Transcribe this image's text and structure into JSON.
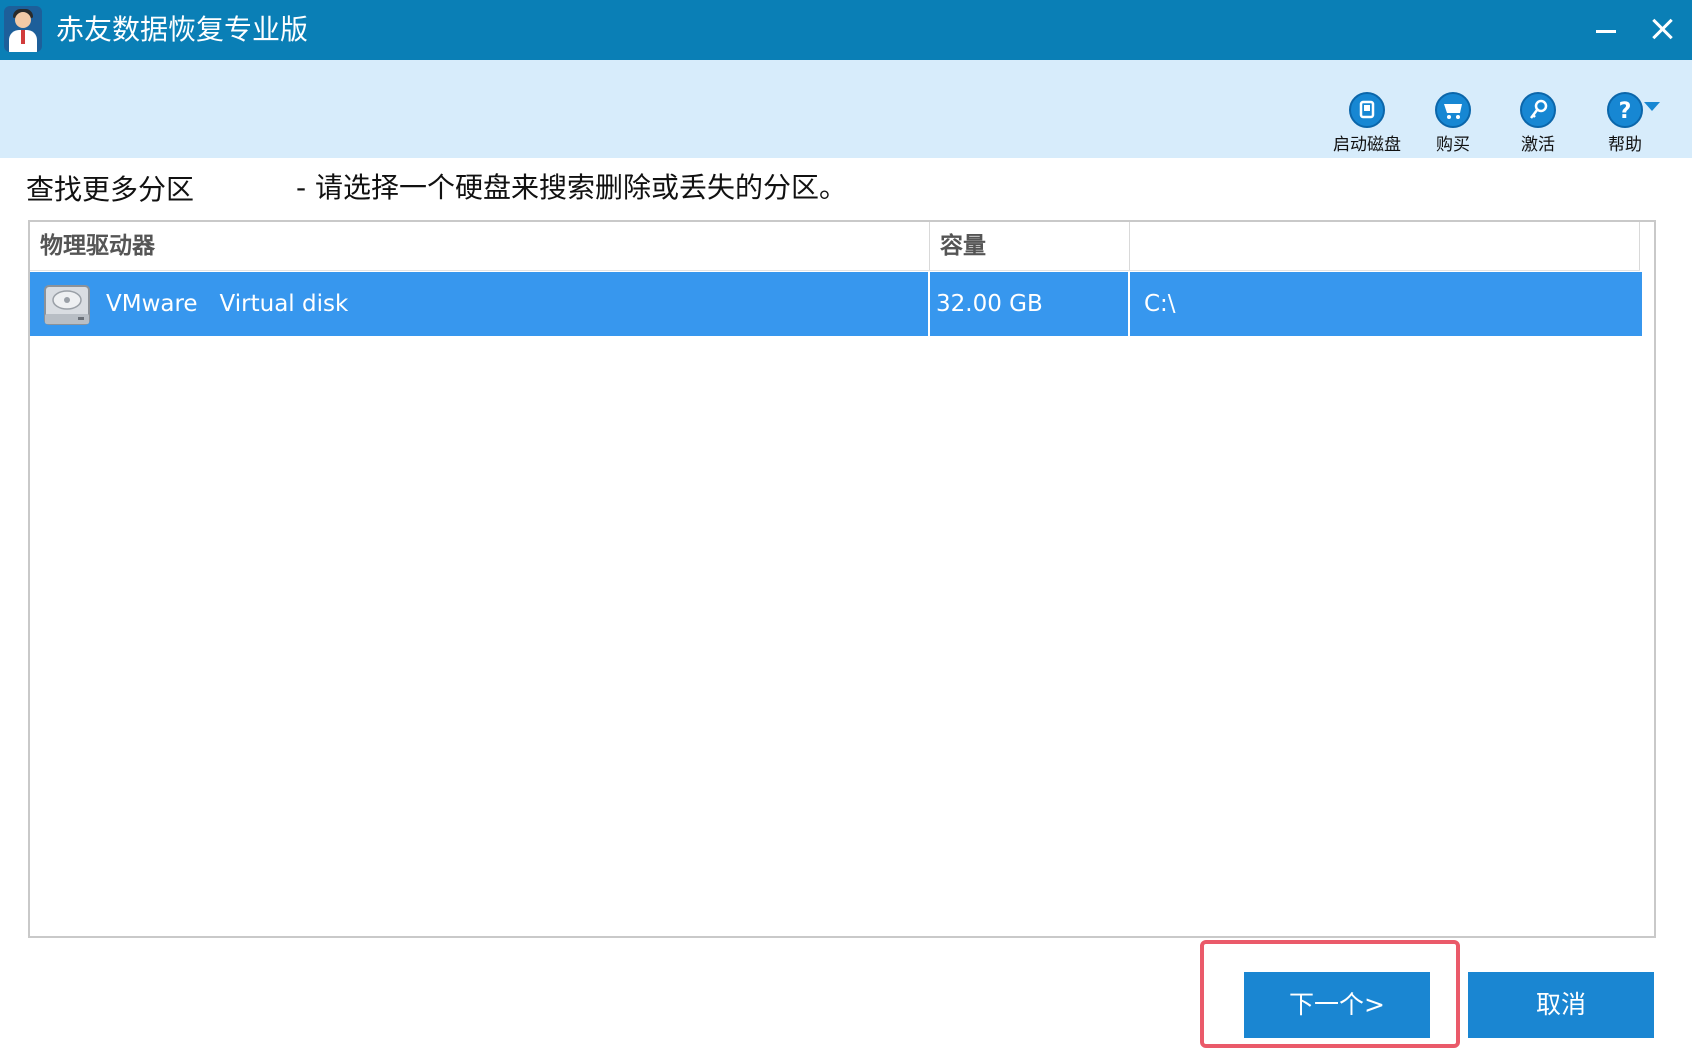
{
  "window": {
    "title": "赤友数据恢复专业版"
  },
  "toolbar": {
    "items": [
      {
        "label": "启动磁盘",
        "icon": "boot-disk-icon"
      },
      {
        "label": "购买",
        "icon": "cart-icon"
      },
      {
        "label": "激活",
        "icon": "key-icon"
      },
      {
        "label": "帮助",
        "icon": "help-icon"
      }
    ]
  },
  "page": {
    "heading": "查找更多分区",
    "instruction": "- 请选择一个硬盘来搜索删除或丢失的分区。"
  },
  "table": {
    "columns": [
      "物理驱动器",
      "容量",
      ""
    ],
    "rows": [
      {
        "drive": "VMware   Virtual disk",
        "capacity": "32.00 GB",
        "partition": "C:\\",
        "selected": true,
        "icon": "hard-disk-icon"
      }
    ]
  },
  "buttons": {
    "next": "下一个>",
    "cancel": "取消"
  },
  "colors": {
    "titlebar": "#0a7fb6",
    "toolbar": "#d7ecfb",
    "selection": "#3797ee",
    "button": "#1a86d2",
    "highlight": "#ea5a6a"
  }
}
